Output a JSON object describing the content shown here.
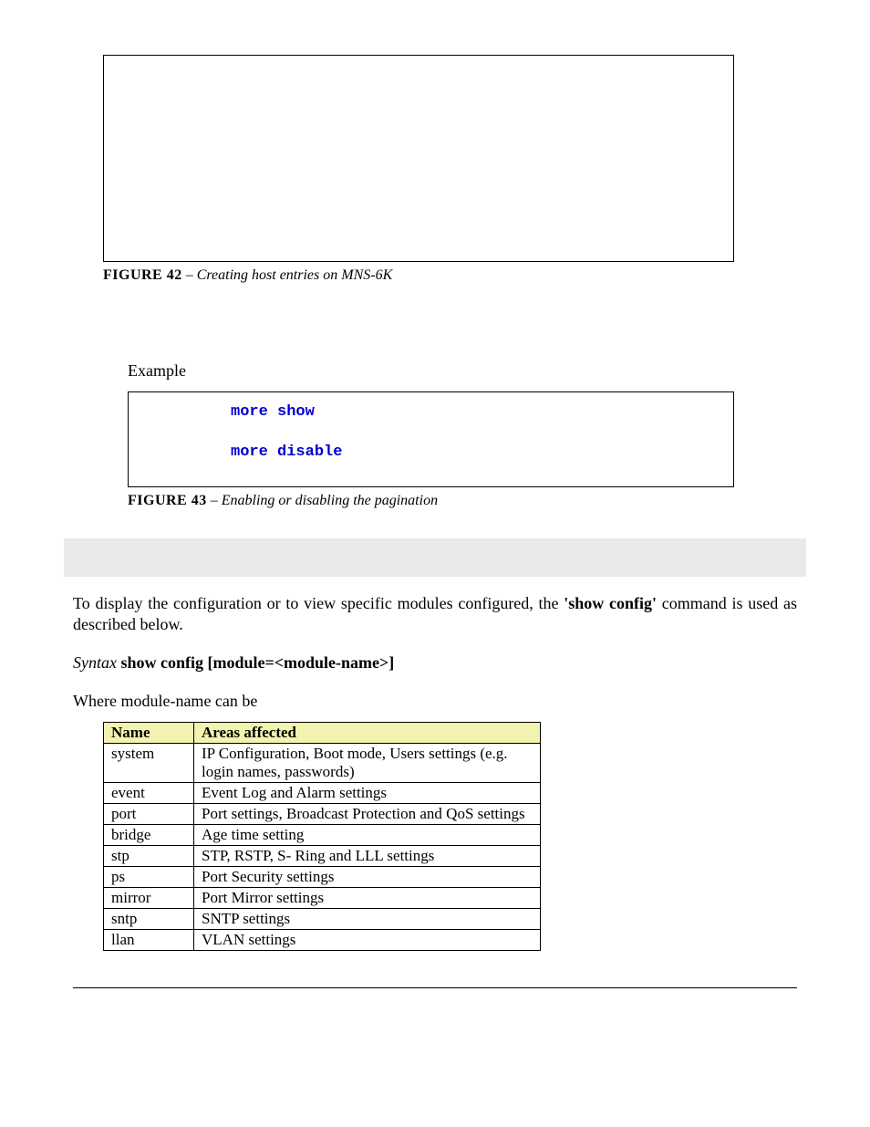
{
  "figure42": {
    "label": "FIGURE 42",
    "sep": " – ",
    "desc": "Creating host entries on MNS-6K"
  },
  "example_label": "Example",
  "code": {
    "line1": "more show",
    "line2": "more disable"
  },
  "figure43": {
    "label": "FIGURE 43",
    "sep": " – ",
    "desc": "Enabling or disabling the pagination"
  },
  "para1_pre": "To display the configuration or to view specific modules configured, the ",
  "para1_bold": "'show config'",
  "para1_post": " command is used as described below.",
  "syntax": {
    "label": "Syntax",
    "cmd": " show config [module=<module-name>]"
  },
  "where_line": "Where module-name can be",
  "table": {
    "h1": "Name",
    "h2": "Areas affected",
    "rows": [
      {
        "n": "system",
        "a": "IP Configuration, Boot mode, Users settings (e.g. login names, passwords)"
      },
      {
        "n": "event",
        "a": "Event Log and Alarm settings"
      },
      {
        "n": "port",
        "a": "Port settings, Broadcast Protection and QoS settings"
      },
      {
        "n": "bridge",
        "a": "Age time setting"
      },
      {
        "n": "stp",
        "a": "STP, RSTP, S- Ring and LLL settings"
      },
      {
        "n": "ps",
        "a": "Port Security settings"
      },
      {
        "n": "mirror",
        "a": "Port Mirror settings"
      },
      {
        "n": "sntp",
        "a": "SNTP settings"
      },
      {
        "n": "llan",
        "a": "VLAN settings"
      }
    ]
  }
}
